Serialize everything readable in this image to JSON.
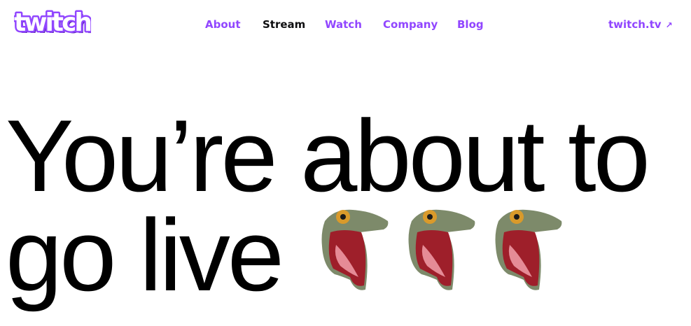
{
  "header": {
    "logo_text": "twitch",
    "nav": [
      {
        "label": "About",
        "active": false
      },
      {
        "label": "Stream",
        "active": true
      },
      {
        "label": "Watch",
        "active": false
      },
      {
        "label": "Company",
        "active": false
      },
      {
        "label": "Blog",
        "active": false
      }
    ],
    "external_link": {
      "label": "twitch.tv",
      "icon": "external-arrow-icon"
    }
  },
  "hero": {
    "line1": "You’re about to",
    "line2": "go live",
    "emotes": [
      {
        "icon": "screaming-dinosaur-emote"
      },
      {
        "icon": "screaming-dinosaur-emote"
      },
      {
        "icon": "screaming-dinosaur-emote"
      }
    ]
  },
  "colors": {
    "brand": "#9146ff",
    "active_nav": "#0e0e10",
    "text": "#000000",
    "background": "#ffffff"
  }
}
